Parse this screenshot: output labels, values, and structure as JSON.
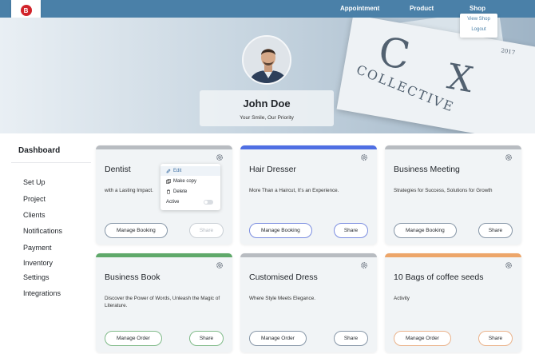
{
  "nav": {
    "logo_letter": "B",
    "links": [
      "Appointment",
      "Product",
      "Shop"
    ],
    "shop_menu": [
      "View Shop",
      "Logout"
    ]
  },
  "hero": {
    "magazine_text": [
      "COLLECTIVE",
      "2017",
      "C",
      "X"
    ]
  },
  "profile": {
    "name": "John Doe",
    "tagline": "Your Smile, Our Priority"
  },
  "sidebar": {
    "title": "Dashboard",
    "items": [
      "Set Up",
      "Project",
      "Clients",
      "Notifications",
      "Payment",
      "Inventory",
      "Settings",
      "Integrations"
    ]
  },
  "cards": [
    {
      "title": "Dentist",
      "subtitle": "with a Lasting Impact.",
      "primary": "Manage Booking",
      "share": "Share",
      "bar_color": "#b8bcc1"
    },
    {
      "title": "Hair Dresser",
      "subtitle": "More Than a Haircut, It's an Experience.",
      "primary": "Manage Booking",
      "share": "Share",
      "bar_color": "#4f6fe3"
    },
    {
      "title": "Business Meeting",
      "subtitle": "Strategies for Success, Solutions for Growth",
      "primary": "Manage  Booking",
      "share": "Share",
      "bar_color": "#b8bcc1"
    },
    {
      "title": "Business Book",
      "subtitle": "Discover the Power of Words, Unleash the Magic of Literature.",
      "primary": "Manage Order",
      "share": "Share",
      "bar_color": "#5fa96a"
    },
    {
      "title": "Customised Dress",
      "subtitle": "Where Style Meets Elegance.",
      "primary": "Manage Order",
      "share": "Share",
      "bar_color": "#b8bcc1"
    },
    {
      "title": "10 Bags of coffee seeds",
      "subtitle": "Activity",
      "primary": "Manage Order",
      "share": "Share",
      "bar_color": "#eda66a"
    }
  ],
  "context_menu": {
    "items": [
      "Edit",
      "Make copy",
      "Delete",
      "Active"
    ]
  }
}
